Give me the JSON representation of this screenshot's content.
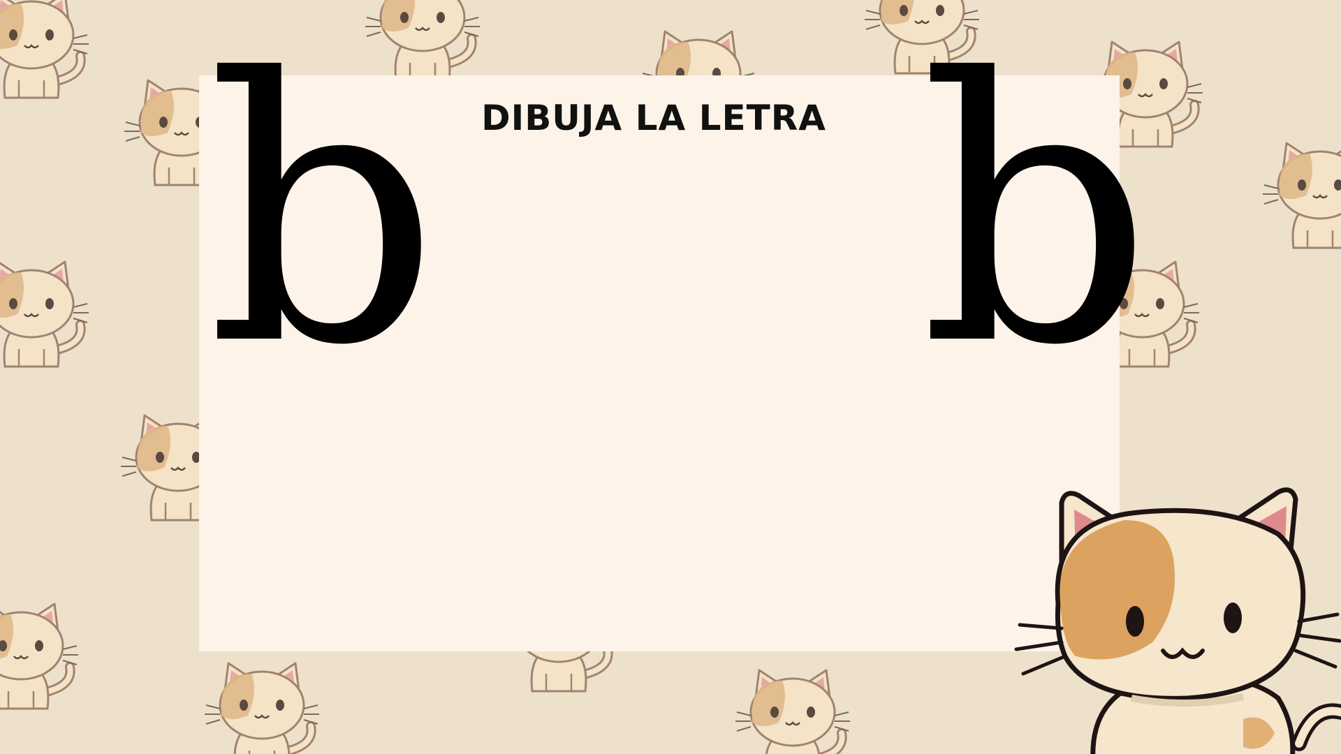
{
  "worksheet": {
    "title": "DIBUJA LA LETRA",
    "letter_left": "b",
    "letter_right": "b"
  },
  "decoration": {
    "background_icon": "kitten-pattern-icon",
    "corner_icon": "kitten-icon"
  },
  "colors": {
    "background": "#ede1cb",
    "card": "#fdf3e9",
    "text": "#000000",
    "cat_fill": "#f5e6cc",
    "cat_patch": "#dba35f",
    "cat_ear": "#de8a8d",
    "cat_outline": "#1e1414"
  }
}
